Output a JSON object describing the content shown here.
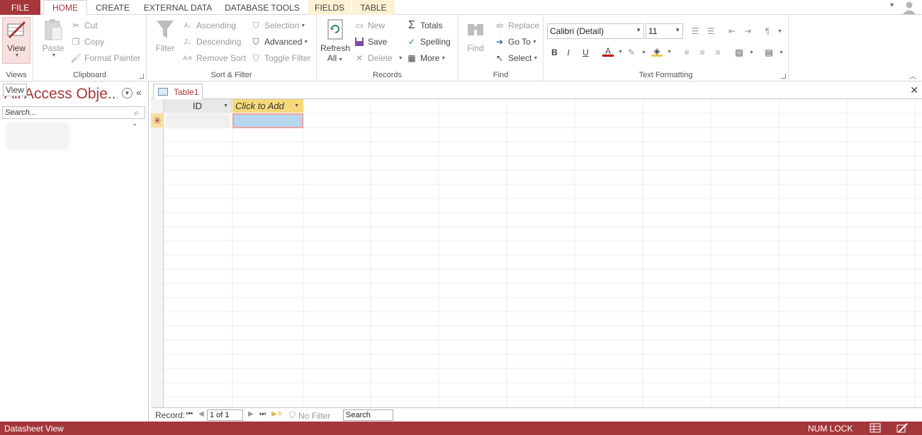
{
  "tabs": {
    "file": "FILE",
    "home": "HOME",
    "create": "CREATE",
    "external_data": "EXTERNAL DATA",
    "database_tools": "DATABASE TOOLS",
    "fields": "FIELDS",
    "table": "TABLE"
  },
  "ribbon": {
    "views": {
      "view": "View",
      "label": "Views"
    },
    "clipboard": {
      "paste": "Paste",
      "cut": "Cut",
      "copy": "Copy",
      "format_painter": "Format Painter",
      "label": "Clipboard"
    },
    "sort_filter": {
      "filter": "Filter",
      "ascending": "Ascending",
      "descending": "Descending",
      "remove_sort": "Remove Sort",
      "selection": "Selection",
      "advanced": "Advanced",
      "toggle_filter": "Toggle Filter",
      "label": "Sort & Filter"
    },
    "records": {
      "refresh": "Refresh",
      "refresh_all": "All",
      "new": "New",
      "save": "Save",
      "delete": "Delete",
      "totals": "Totals",
      "spelling": "Spelling",
      "more": "More",
      "label": "Records"
    },
    "find": {
      "find": "Find",
      "replace": "Replace",
      "goto": "Go To",
      "select": "Select",
      "label": "Find"
    },
    "text_formatting": {
      "font": "Calibri (Detail)",
      "size": "11",
      "bold": "B",
      "italic": "I",
      "underline": "U",
      "label": "Text Formatting"
    }
  },
  "nav_pane": {
    "title": "All Access Obje...",
    "tooltip": "View",
    "search_placeholder": "Search..."
  },
  "document": {
    "tab": "Table1",
    "columns": {
      "id": "ID",
      "add": "Click to Add"
    }
  },
  "record_nav": {
    "label": "Record:",
    "position": "1 of 1",
    "no_filter": "No Filter",
    "search": "Search"
  },
  "status": {
    "view": "Datasheet View",
    "numlock": "NUM LOCK"
  },
  "colors": {
    "accent": "#a4373a",
    "header_add": "#f5d97a",
    "active_cell": "#b7d6ee"
  }
}
